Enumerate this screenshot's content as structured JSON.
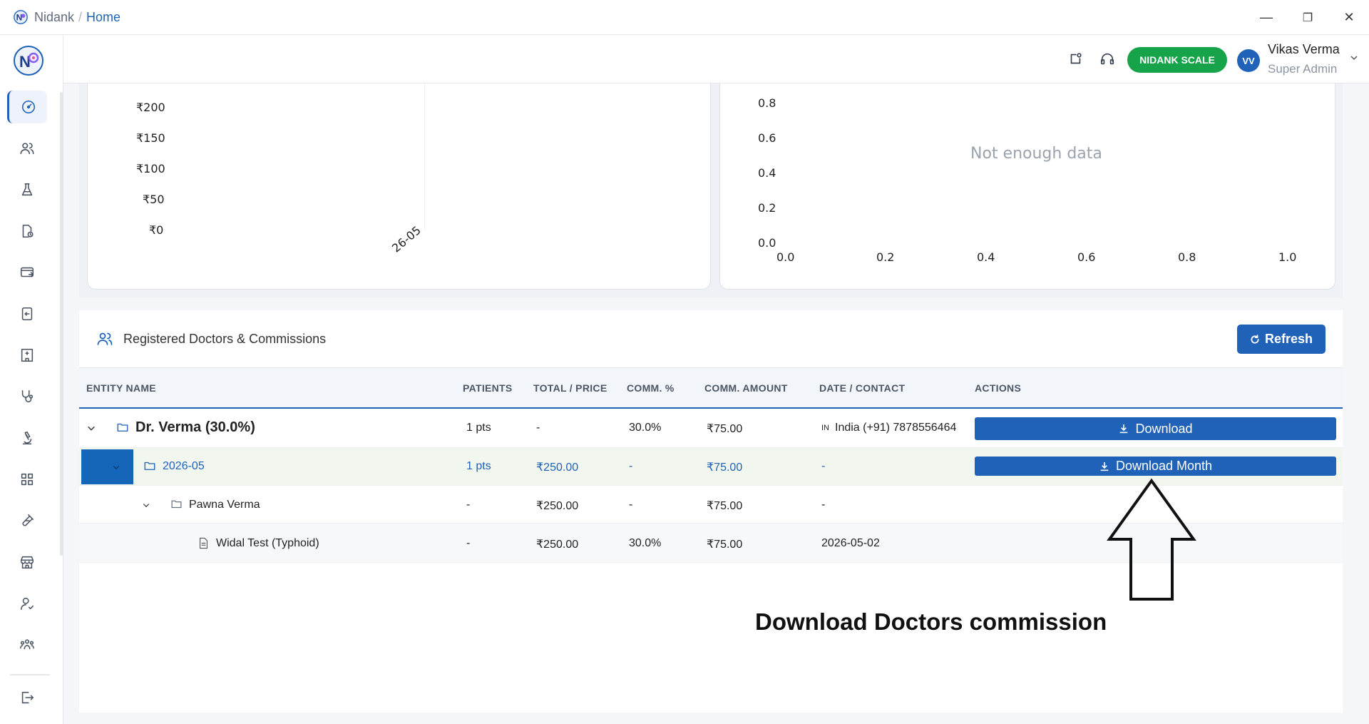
{
  "app": {
    "name": "Nidank",
    "separator": "/",
    "page": "Home"
  },
  "window_controls": {
    "minimize": "—",
    "restore": "❐",
    "close": "✕"
  },
  "sidebar": {
    "items": [
      {
        "icon": "dashboard-icon",
        "active": true
      },
      {
        "icon": "users-icon"
      },
      {
        "icon": "flask-icon"
      },
      {
        "icon": "report-icon"
      },
      {
        "icon": "billing-icon"
      },
      {
        "icon": "returns-icon"
      },
      {
        "icon": "hospital-icon"
      },
      {
        "icon": "stethoscope-icon"
      },
      {
        "icon": "microscope-icon"
      },
      {
        "icon": "apps-grid-icon"
      },
      {
        "icon": "test-tube-icon"
      },
      {
        "icon": "store-icon"
      },
      {
        "icon": "user-check-icon"
      },
      {
        "icon": "team-icon"
      },
      {
        "icon": "logout-icon"
      }
    ]
  },
  "header": {
    "scale_label": "NIDANK SCALE",
    "user": {
      "initials": "VV",
      "name": "Vikas Verma",
      "role": "Super Admin"
    }
  },
  "charts": {
    "left": {
      "y_ticks": [
        "₹200",
        "₹150",
        "₹100",
        "₹50",
        "₹0"
      ],
      "x_ticks": [
        "26-05"
      ]
    },
    "right": {
      "y_ticks": [
        "0.8",
        "0.6",
        "0.4",
        "0.2",
        "0.0"
      ],
      "x_ticks": [
        "0.0",
        "0.2",
        "0.4",
        "0.6",
        "0.8",
        "1.0"
      ],
      "message": "Not enough data"
    }
  },
  "panel": {
    "title": "Registered Doctors & Commissions",
    "refresh_label": "Refresh",
    "columns": [
      "ENTITY NAME",
      "PATIENTS",
      "TOTAL / PRICE",
      "COMM. %",
      "COMM. AMOUNT",
      "DATE / CONTACT",
      "ACTIONS"
    ],
    "rows": {
      "doctor": {
        "name": "Dr. Verma (30.0%)",
        "patients": "1 pts",
        "total": "-",
        "comm_pct": "30.0%",
        "comm_amount": "₹75.00",
        "contact_flag": "IN",
        "contact": "India (+91) 7878556464",
        "action": "Download"
      },
      "month": {
        "name": "2026-05",
        "patients": "1 pts",
        "total": "₹250.00",
        "comm_pct": "-",
        "comm_amount": "₹75.00",
        "date": "-",
        "action": "Download Month"
      },
      "patient": {
        "name": "Pawna Verma",
        "patients": "-",
        "total": "₹250.00",
        "comm_pct": "-",
        "comm_amount": "₹75.00",
        "date": "-"
      },
      "test": {
        "name": "Widal Test (Typhoid)",
        "patients": "-",
        "total": "₹250.00",
        "comm_pct": "30.0%",
        "comm_amount": "₹75.00",
        "date": "2026-05-02"
      }
    }
  },
  "annotation": {
    "text": "Download Doctors commission"
  },
  "colors": {
    "primary": "#1f62b8",
    "success": "#17a34a",
    "muted": "#9aa3ad"
  }
}
